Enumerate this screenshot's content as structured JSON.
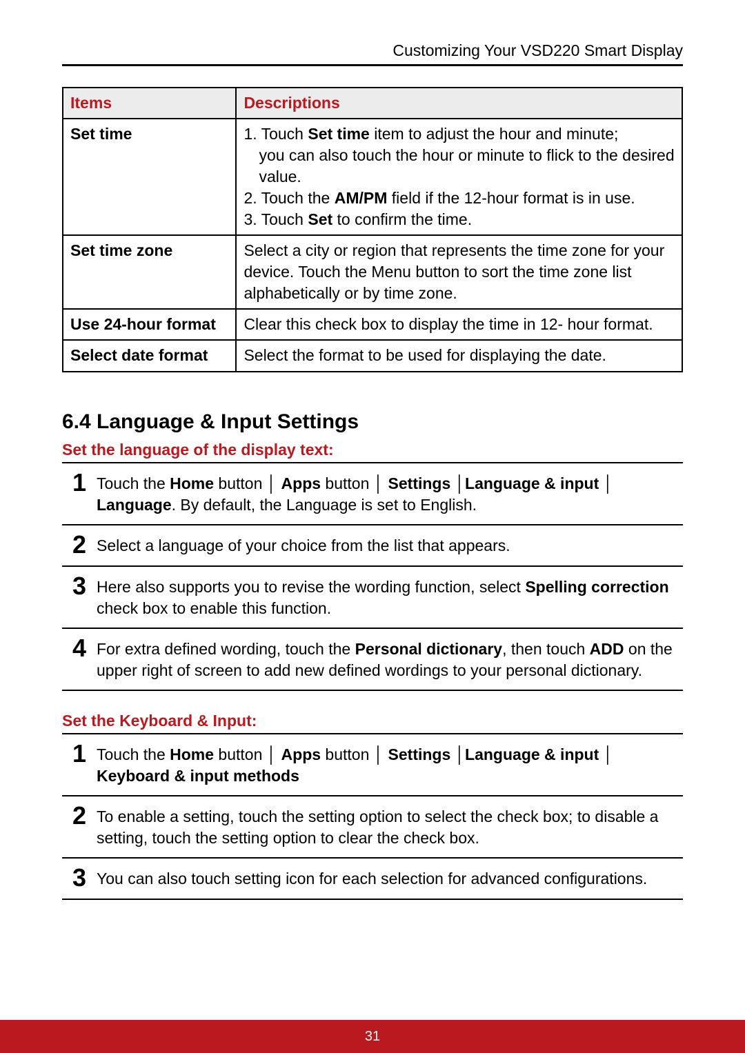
{
  "header": "Customizing Your VSD220 Smart Display",
  "table": {
    "headers": {
      "c1": "Items",
      "c2": "Descriptions"
    },
    "rows": {
      "r1": {
        "item": "Set time",
        "d1_pre": "1. Touch ",
        "d1_b": "Set time",
        "d1_post": " item to adjust the hour and minute;",
        "d1_sub": "you can also touch the hour or minute to flick to the desired value.",
        "d2_pre": "2. Touch the ",
        "d2_b": "AM/PM",
        "d2_post": " field if the 12-hour format is in use.",
        "d3_pre": "3. Touch ",
        "d3_b": "Set",
        "d3_post": " to confirm the time."
      },
      "r2": {
        "item": "Set time zone",
        "desc": "Select a city or region that represents the time zone for your device. Touch the Menu button to sort the time zone list alphabetically or by time zone."
      },
      "r3": {
        "item": "Use 24-hour format",
        "desc": "Clear this check box to display the time in 12- hour format."
      },
      "r4": {
        "item": "Select date format",
        "desc": "Select the format to be used for displaying the date."
      }
    }
  },
  "section_title": "6.4  Language & Input Settings",
  "lang": {
    "title": "Set the language of the display text:",
    "steps": {
      "s1": {
        "n": "1",
        "t1": "Touch the ",
        "b1": "Home",
        "t2": " button │ ",
        "b2": "Apps",
        "t3": " button │ ",
        "b3": "Settings",
        "t4": " │",
        "b4": "Language & input",
        "t5": " │ ",
        "b5": "Language",
        "t6": ". By default, the Language is set to English."
      },
      "s2": {
        "n": "2",
        "text": "Select a language of your choice from the list that appears."
      },
      "s3": {
        "n": "3",
        "t1": "Here also supports you to revise the wording function, select ",
        "b1": "Spelling correction",
        "t2": " check box to enable this function."
      },
      "s4": {
        "n": "4",
        "t1": "For extra defined wording, touch the ",
        "b1": "Personal dictionary",
        "t2": ", then touch ",
        "b2": "ADD",
        "t3": " on the upper right of screen to add new defined wordings to your personal dictionary."
      }
    }
  },
  "kb": {
    "title": "Set the Keyboard & Input:",
    "steps": {
      "s1": {
        "n": "1",
        "t1": "Touch the ",
        "b1": "Home",
        "t2": " button │ ",
        "b2": "Apps",
        "t3": " button │ ",
        "b3": "Settings",
        "t4": " │",
        "b4": "Language & input",
        "t5": " │ ",
        "b5": "Keyboard & input methods"
      },
      "s2": {
        "n": "2",
        "text": "To enable a setting, touch the setting option to select the check box; to disable a setting, touch the setting option to clear the check box."
      },
      "s3": {
        "n": "3",
        "text": "You can also touch setting icon for each selection for advanced configurations."
      }
    }
  },
  "page_number": "31"
}
